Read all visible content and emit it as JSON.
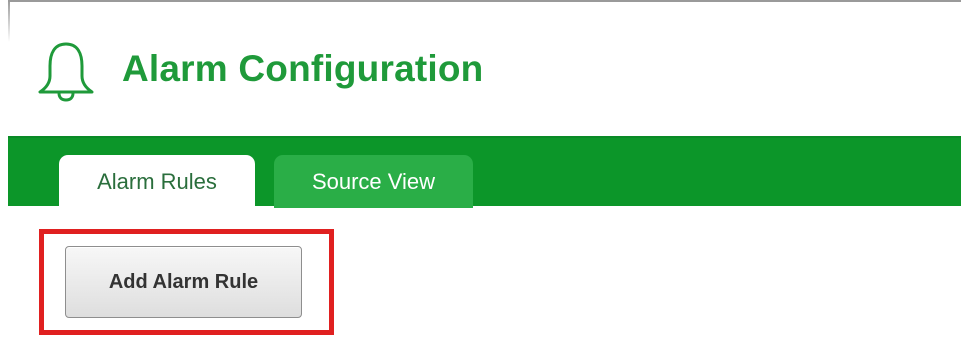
{
  "header": {
    "title": "Alarm Configuration",
    "icon": "bell-icon"
  },
  "tabs": [
    {
      "label": "Alarm Rules",
      "active": true
    },
    {
      "label": "Source View",
      "active": false
    }
  ],
  "toolbar": {
    "add_label": "Add Alarm Rule"
  },
  "colors": {
    "brand_green": "#0c9629",
    "title_green": "#1f9a3a",
    "highlight_red": "#e02020"
  }
}
